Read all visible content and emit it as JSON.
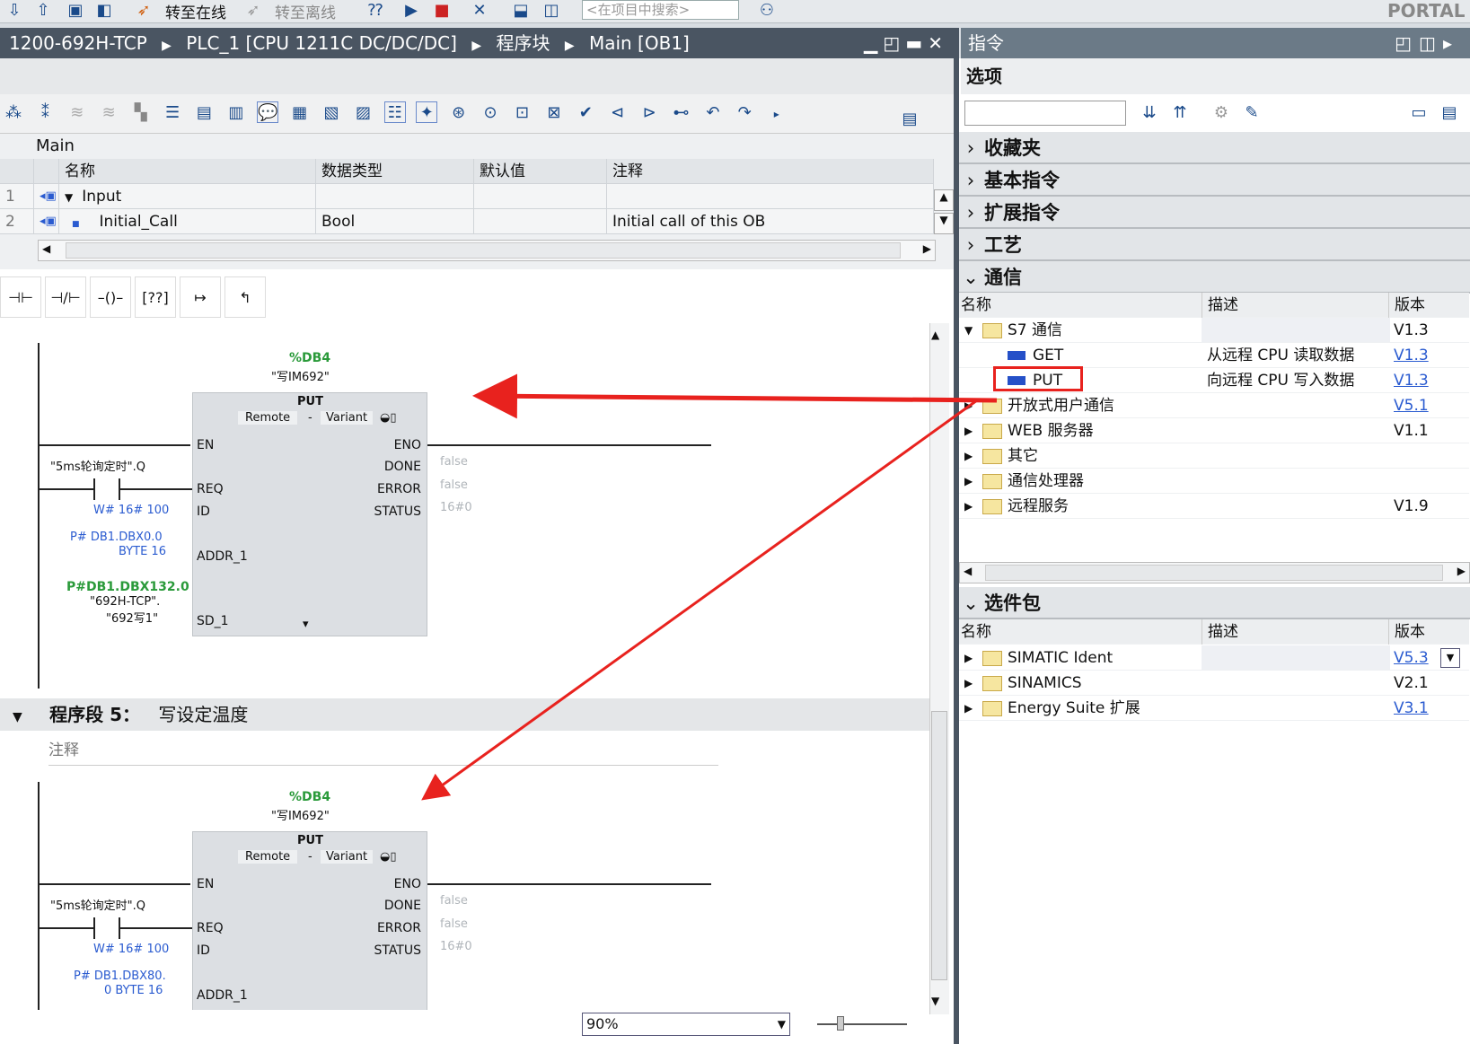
{
  "toolbar": {
    "go_online": "转至在线",
    "go_offline": "转至离线",
    "search_placeholder": "<在项目中搜索>",
    "brand": "PORTAL"
  },
  "breadcrumb": {
    "project": "1200-692H-TCP",
    "plc": "PLC_1 [CPU 1211C DC/DC/DC]",
    "folder": "程序块",
    "block": "Main [OB1]",
    "sep": "▶"
  },
  "instructions_pane": {
    "title": "指令",
    "options": "选项"
  },
  "interface": {
    "block_name": "Main",
    "headers": [
      "名称",
      "数据类型",
      "默认值",
      "注释"
    ],
    "rows": [
      {
        "num": "1",
        "name": "Input",
        "type": "",
        "default": "",
        "comment": ""
      },
      {
        "num": "2",
        "name": "Initial_Call",
        "type": "Bool",
        "default": "",
        "comment": "Initial call of this OB"
      }
    ]
  },
  "network4": {
    "db_addr": "%DB4",
    "db_name": "\"写IM692\"",
    "block": "PUT",
    "remote": "Remote",
    "dash": "-",
    "variant": "Variant",
    "contact": "\"5ms轮询定时\".Q",
    "id": "W# 16# 100",
    "addr1a": "P# DB1.DBX0.0",
    "addr1b": "BYTE 16",
    "sd1a": "P#DB1.DBX132.0",
    "sd1b": "\"692H-TCP\".",
    "sd1c": "\"692写1\"",
    "pins_in": [
      "EN",
      "REQ",
      "ID",
      "ADDR_1",
      "SD_1"
    ],
    "pins_out": [
      "ENO",
      "DONE",
      "ERROR",
      "STATUS"
    ],
    "done_v": "false",
    "error_v": "false",
    "status_v": "16#0"
  },
  "network5": {
    "title": "程序段 5：",
    "desc": "写设定温度",
    "comment": "注释",
    "db_addr": "%DB4",
    "db_name": "\"写IM692\"",
    "block": "PUT",
    "remote": "Remote",
    "dash": "-",
    "variant": "Variant",
    "contact": "\"5ms轮询定时\".Q",
    "id": "W# 16# 100",
    "addr1a": "P# DB1.DBX80.",
    "addr1b": "0 BYTE 16",
    "pins_in": [
      "EN",
      "REQ",
      "ID",
      "ADDR_1"
    ],
    "pins_out": [
      "ENO",
      "DONE",
      "ERROR",
      "STATUS"
    ],
    "done_v": "false",
    "error_v": "false",
    "status_v": "16#0"
  },
  "zoom": "90%",
  "palettes": {
    "favorites": "收藏夹",
    "basic": "基本指令",
    "extended": "扩展指令",
    "technology": "工艺",
    "communication": "通信",
    "optional": "选件包"
  },
  "comm": {
    "headers": [
      "名称",
      "描述",
      "版本"
    ],
    "rows": [
      {
        "name": "S7 通信",
        "desc": "",
        "ver": "V1.3",
        "kind": "folder",
        "open": true
      },
      {
        "name": "GET",
        "desc": "从远程 CPU 读取数据",
        "ver": "V1.3",
        "kind": "block"
      },
      {
        "name": "PUT",
        "desc": "向远程 CPU 写入数据",
        "ver": "V1.3",
        "kind": "block"
      },
      {
        "name": "开放式用户通信",
        "desc": "",
        "ver": "V5.1",
        "kind": "folder"
      },
      {
        "name": "WEB 服务器",
        "desc": "",
        "ver": "V1.1",
        "kind": "folder"
      },
      {
        "name": "其它",
        "desc": "",
        "ver": "",
        "kind": "folder"
      },
      {
        "name": "通信处理器",
        "desc": "",
        "ver": "",
        "kind": "folder"
      },
      {
        "name": "远程服务",
        "desc": "",
        "ver": "V1.9",
        "kind": "folder"
      }
    ]
  },
  "optional": {
    "headers": [
      "名称",
      "描述",
      "版本"
    ],
    "rows": [
      {
        "name": "SIMATIC Ident",
        "ver": "V5.3"
      },
      {
        "name": "SINAMICS",
        "ver": "V2.1"
      },
      {
        "name": "Energy Suite 扩展",
        "ver": "V3.1"
      }
    ]
  },
  "colors": {
    "accent_red": "#e8221e",
    "title_bar": "#4a5562"
  }
}
